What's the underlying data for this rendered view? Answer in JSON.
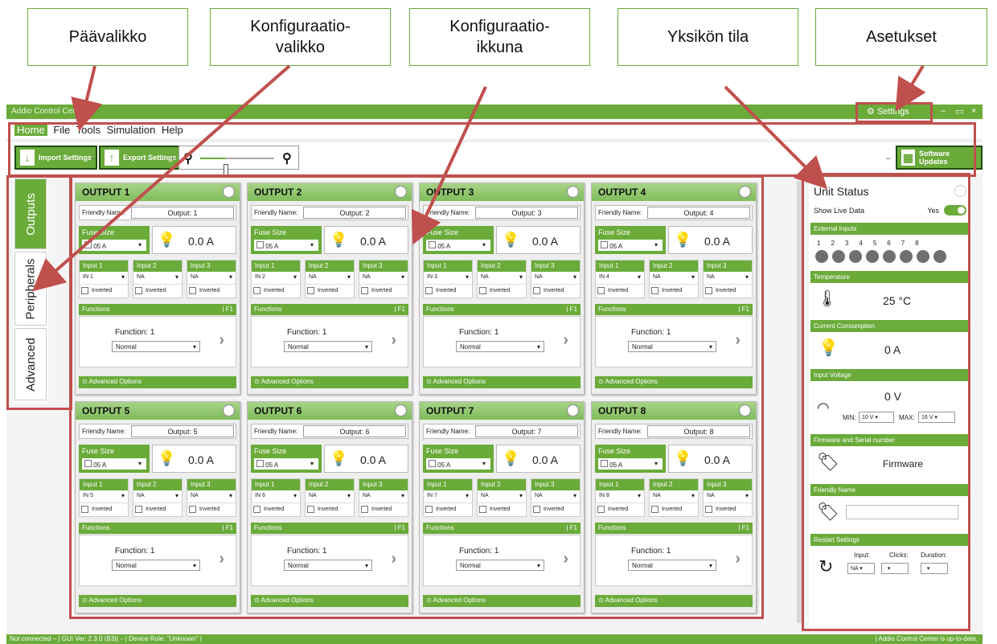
{
  "callouts": [
    "Päävalikko",
    "Konfiguraatio-valikko",
    "Konfiguraatio-ikkuna",
    "Yksikön tila",
    "Asetukset"
  ],
  "window": {
    "title": "Addio Control Center",
    "settings_label": "Settings",
    "min": "–",
    "max": "▭",
    "close": "×"
  },
  "menu": [
    "Home",
    "File",
    "Tools",
    "Simulation",
    "Help"
  ],
  "toolbar": {
    "import": "Import Settings",
    "export": "Export Settings",
    "updates": "Software Updates",
    "sep": "–",
    "zoom_level": 0.35
  },
  "sidetabs": [
    "Outputs",
    "Peripherals",
    "Advanced"
  ],
  "outputs": [
    {
      "title": "OUTPUT  1",
      "friendly_label": "Friendly Name:",
      "friendly": "Output: 1",
      "fuse_label": "Fuse Size",
      "fuse": "05 A",
      "current": "0.0 A",
      "in_labels": [
        "Input 1",
        "Input 2",
        "Input 3"
      ],
      "in_vals": [
        "IN 1",
        "NA",
        "NA"
      ],
      "inverted": "Inverted",
      "functions": "Functions",
      "f_tag": "| F1",
      "func_name": "Function: 1",
      "func_mode": "Normal",
      "advanced": "Advanced Options"
    },
    {
      "title": "OUTPUT  2",
      "friendly_label": "Friendly Name:",
      "friendly": "Output: 2",
      "fuse_label": "Fuse Size",
      "fuse": "05 A",
      "current": "0.0 A",
      "in_labels": [
        "Input 1",
        "Input 2",
        "Input 3"
      ],
      "in_vals": [
        "IN 2",
        "NA",
        "NA"
      ],
      "inverted": "Inverted",
      "functions": "Functions",
      "f_tag": "| F1",
      "func_name": "Function: 1",
      "func_mode": "Normal",
      "advanced": "Advanced Options"
    },
    {
      "title": "OUTPUT  3",
      "friendly_label": "Friendly Name:",
      "friendly": "Output: 3",
      "fuse_label": "Fuse Size",
      "fuse": "05 A",
      "current": "0.0 A",
      "in_labels": [
        "Input 1",
        "Input 2",
        "Input 3"
      ],
      "in_vals": [
        "IN 3",
        "NA",
        "NA"
      ],
      "inverted": "Inverted",
      "functions": "Functions",
      "f_tag": "| F1",
      "func_name": "Function: 1",
      "func_mode": "Normal",
      "advanced": "Advanced Options"
    },
    {
      "title": "OUTPUT  4",
      "friendly_label": "Friendly Name:",
      "friendly": "Output: 4",
      "fuse_label": "Fuse Size",
      "fuse": "05 A",
      "current": "0.0 A",
      "in_labels": [
        "Input 1",
        "Input 2",
        "Input 3"
      ],
      "in_vals": [
        "IN 4",
        "NA",
        "NA"
      ],
      "inverted": "Inverted",
      "functions": "Functions",
      "f_tag": "| F1",
      "func_name": "Function: 1",
      "func_mode": "Normal",
      "advanced": "Advanced Options"
    },
    {
      "title": "OUTPUT  5",
      "friendly_label": "Friendly Name:",
      "friendly": "Output: 5",
      "fuse_label": "Fuse Size",
      "fuse": "05 A",
      "current": "0.0 A",
      "in_labels": [
        "Input 1",
        "Input 2",
        "Input 3"
      ],
      "in_vals": [
        "IN 5",
        "NA",
        "NA"
      ],
      "inverted": "Inverted",
      "functions": "Functions",
      "f_tag": "| F1",
      "func_name": "Function: 1",
      "func_mode": "Normal",
      "advanced": "Advanced Options"
    },
    {
      "title": "OUTPUT  6",
      "friendly_label": "Friendly Name:",
      "friendly": "Output: 6",
      "fuse_label": "Fuse Size",
      "fuse": "05 A",
      "current": "0.0 A",
      "in_labels": [
        "Input 1",
        "Input 2",
        "Input 3"
      ],
      "in_vals": [
        "IN 6",
        "NA",
        "NA"
      ],
      "inverted": "Inverted",
      "functions": "Functions",
      "f_tag": "| F1",
      "func_name": "Function: 1",
      "func_mode": "Normal",
      "advanced": "Advanced Options"
    },
    {
      "title": "OUTPUT  7",
      "friendly_label": "Friendly Name:",
      "friendly": "Output: 7",
      "fuse_label": "Fuse Size",
      "fuse": "05 A",
      "current": "0.0 A",
      "in_labels": [
        "Input 1",
        "Input 2",
        "Input 3"
      ],
      "in_vals": [
        "IN 7",
        "NA",
        "NA"
      ],
      "inverted": "Inverted",
      "functions": "Functions",
      "f_tag": "| F1",
      "func_name": "Function: 1",
      "func_mode": "Normal",
      "advanced": "Advanced Options"
    },
    {
      "title": "OUTPUT  8",
      "friendly_label": "Friendly Name:",
      "friendly": "Output: 8",
      "fuse_label": "Fuse Size",
      "fuse": "05 A",
      "current": "0.0 A",
      "in_labels": [
        "Input 1",
        "Input 2",
        "Input 3"
      ],
      "in_vals": [
        "IN 8",
        "NA",
        "NA"
      ],
      "inverted": "Inverted",
      "functions": "Functions",
      "f_tag": "| F1",
      "func_name": "Function: 1",
      "func_mode": "Normal",
      "advanced": "Advanced Options"
    }
  ],
  "unit_status": {
    "title": "Unit Status",
    "live_label": "Show Live Data",
    "live_value": "Yes",
    "ext_inputs": "External Inputs",
    "ext_numbers": [
      "1",
      "2",
      "3",
      "4",
      "5",
      "6",
      "7",
      "8"
    ],
    "temperature": "Temperature",
    "temp_value": "25 °C",
    "current": "Current Consumption",
    "current_value": "0 A",
    "voltage": "Input Voltage",
    "voltage_value": "0 V",
    "min_label": "MIN:",
    "min_value": "10 V",
    "max_label": "MAX:",
    "max_value": "16 V",
    "firmware_header": "Firmware and Serial number",
    "firmware_value": "Firmware",
    "friendly_header": "Friendly Name",
    "restart_header": "Restart Settings",
    "input_label": "Input:",
    "clicks_label": "Clicks:",
    "duration_label": "Duration:",
    "input_value": "NA"
  },
  "statusbar": {
    "left": "Not connected – | GUI Ver: 2.3.0 (B3)| – | Device Role: \"Unknown\" |",
    "right": "| Addio Control Center is up-to-date."
  },
  "colors": {
    "accent": "#6aab3a",
    "annotation": "#c0504d"
  }
}
